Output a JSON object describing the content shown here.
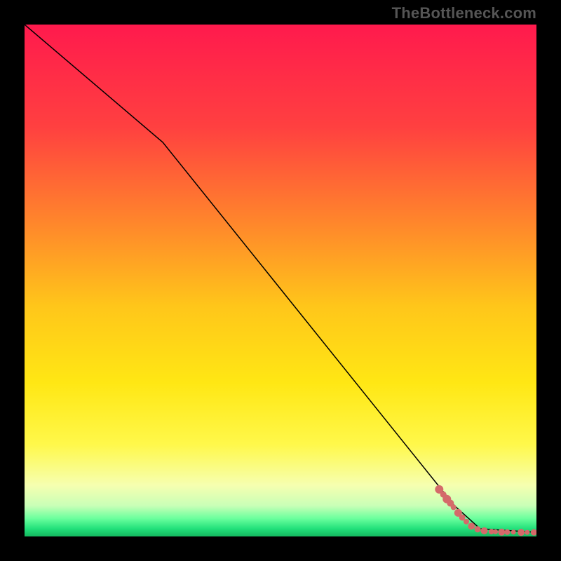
{
  "watermark": "TheBottleneck.com",
  "chart_data": {
    "type": "line",
    "title": "",
    "xlabel": "",
    "ylabel": "",
    "xlim": [
      0,
      100
    ],
    "ylim": [
      0,
      100
    ],
    "grid": false,
    "background_gradient": {
      "stops": [
        {
          "offset": 0.0,
          "color": "#ff1a4d"
        },
        {
          "offset": 0.2,
          "color": "#ff4040"
        },
        {
          "offset": 0.4,
          "color": "#ff8b2a"
        },
        {
          "offset": 0.55,
          "color": "#ffc61a"
        },
        {
          "offset": 0.7,
          "color": "#ffe714"
        },
        {
          "offset": 0.82,
          "color": "#fff84a"
        },
        {
          "offset": 0.9,
          "color": "#f6ffb0"
        },
        {
          "offset": 0.94,
          "color": "#c9ffb7"
        },
        {
          "offset": 0.965,
          "color": "#6aff9d"
        },
        {
          "offset": 0.985,
          "color": "#22e07a"
        },
        {
          "offset": 1.0,
          "color": "#14b85f"
        }
      ]
    },
    "series": [
      {
        "name": "curve",
        "type": "line",
        "color": "#000000",
        "width": 1.5,
        "points": [
          {
            "x": 0,
            "y": 100
          },
          {
            "x": 27,
            "y": 77
          },
          {
            "x": 84,
            "y": 6
          },
          {
            "x": 89,
            "y": 1.5
          },
          {
            "x": 100,
            "y": 0.8
          }
        ]
      },
      {
        "name": "markers",
        "type": "scatter",
        "color": "#d46a6a",
        "radius_default": 5,
        "points": [
          {
            "x": 81.0,
            "y": 9.2,
            "r": 6
          },
          {
            "x": 81.8,
            "y": 8.2,
            "r": 4.5
          },
          {
            "x": 82.5,
            "y": 7.3,
            "r": 6
          },
          {
            "x": 83.2,
            "y": 6.5,
            "r": 5
          },
          {
            "x": 83.8,
            "y": 5.7,
            "r": 4
          },
          {
            "x": 84.7,
            "y": 4.6,
            "r": 5.5
          },
          {
            "x": 85.5,
            "y": 3.7,
            "r": 4.5
          },
          {
            "x": 86.3,
            "y": 2.9,
            "r": 4
          },
          {
            "x": 87.3,
            "y": 2.0,
            "r": 5
          },
          {
            "x": 88.5,
            "y": 1.4,
            "r": 4.5
          },
          {
            "x": 89.8,
            "y": 1.1,
            "r": 5
          },
          {
            "x": 91.2,
            "y": 0.95,
            "r": 4
          },
          {
            "x": 92.0,
            "y": 0.9,
            "r": 3.5
          },
          {
            "x": 93.2,
            "y": 0.85,
            "r": 5
          },
          {
            "x": 94.3,
            "y": 0.85,
            "r": 4
          },
          {
            "x": 95.5,
            "y": 0.85,
            "r": 3.5
          },
          {
            "x": 97.0,
            "y": 0.8,
            "r": 5
          },
          {
            "x": 98.2,
            "y": 0.8,
            "r": 3.5
          },
          {
            "x": 99.5,
            "y": 0.8,
            "r": 4.5
          }
        ]
      }
    ]
  }
}
